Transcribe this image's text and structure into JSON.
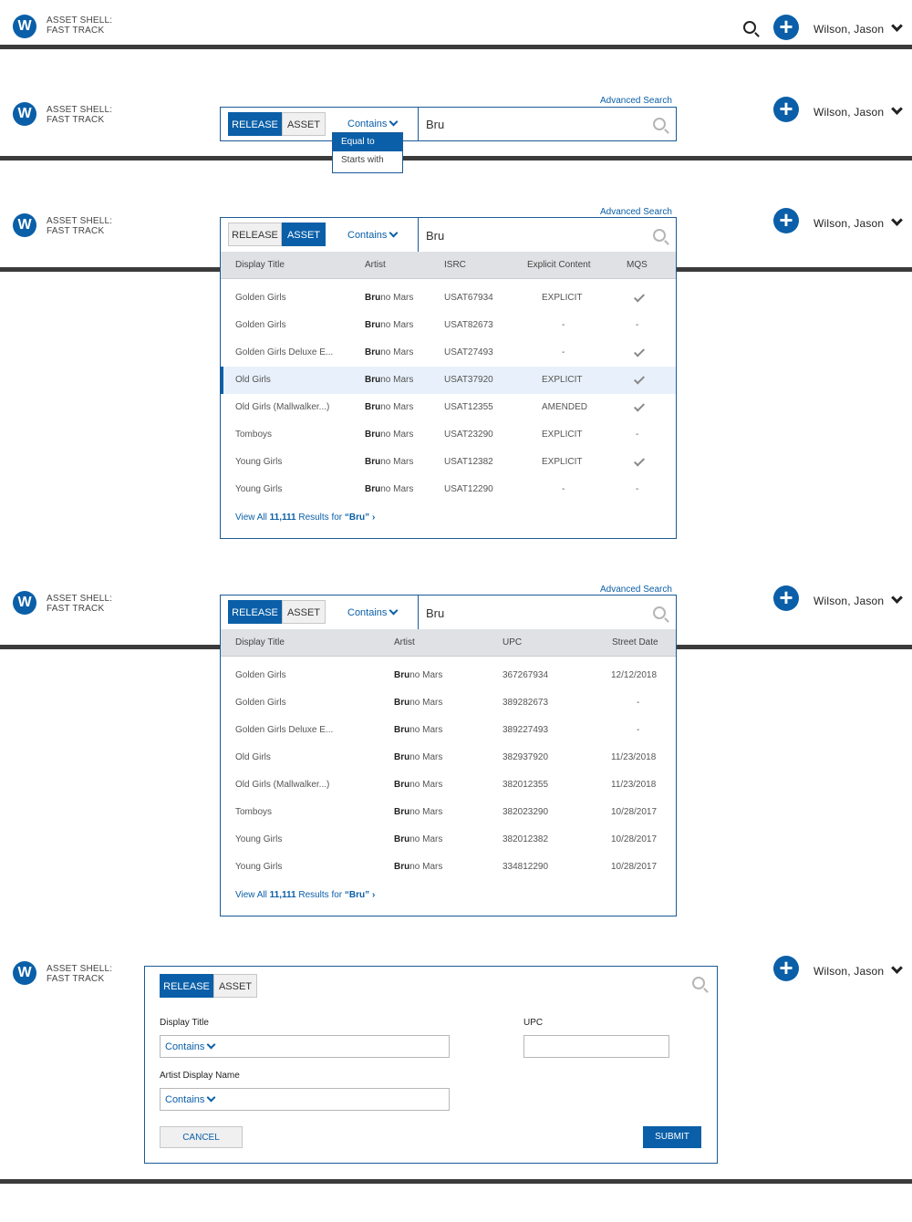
{
  "brand": {
    "line1": "ASSET SHELL:",
    "line2": "FAST TRACK",
    "logo_glyph": "W"
  },
  "user": {
    "name": "Wilson, Jason"
  },
  "search": {
    "tabs": {
      "release": "RELEASE",
      "asset": "ASSET"
    },
    "operator": "Contains",
    "query": "Bru",
    "advanced_label": "Advanced Search",
    "operator_options": [
      "Equal to",
      "Starts with"
    ]
  },
  "asset_table": {
    "headers": [
      "Display Title",
      "Artist",
      "ISRC",
      "Explicit Content",
      "MQS"
    ],
    "rows": [
      {
        "title": "Golden Girls",
        "artist_match": "Bru",
        "artist_rest": "no Mars",
        "isrc": "USAT67934",
        "explicit": "EXPLICIT",
        "mqs": "check"
      },
      {
        "title": "Golden Girls",
        "artist_match": "Bru",
        "artist_rest": "no Mars",
        "isrc": "USAT82673",
        "explicit": "-",
        "mqs": "-"
      },
      {
        "title": "Golden Girls Deluxe E...",
        "artist_match": "Bru",
        "artist_rest": "no Mars",
        "isrc": "USAT27493",
        "explicit": "-",
        "mqs": "check"
      },
      {
        "title": "Old Girls",
        "artist_match": "Bru",
        "artist_rest": "no Mars",
        "isrc": "USAT37920",
        "explicit": "EXPLICIT",
        "mqs": "check",
        "selected": true
      },
      {
        "title": "Old Girls (Mallwalker...)",
        "artist_match": "Bru",
        "artist_rest": "no Mars",
        "isrc": "USAT12355",
        "explicit": "AMENDED",
        "mqs": "check"
      },
      {
        "title": "Tomboys",
        "artist_match": "Bru",
        "artist_rest": "no Mars",
        "isrc": "USAT23290",
        "explicit": "EXPLICIT",
        "mqs": "-"
      },
      {
        "title": "Young Girls",
        "artist_match": "Bru",
        "artist_rest": "no Mars",
        "isrc": "USAT12382",
        "explicit": "EXPLICIT",
        "mqs": "check"
      },
      {
        "title": "Young Girls",
        "artist_match": "Bru",
        "artist_rest": "no Mars",
        "isrc": "USAT12290",
        "explicit": "-",
        "mqs": "-"
      }
    ]
  },
  "release_table": {
    "headers": [
      "Display Title",
      "Artist",
      "UPC",
      "Street Date"
    ],
    "rows": [
      {
        "title": "Golden Girls",
        "artist_match": "Bru",
        "artist_rest": "no Mars",
        "upc": "367267934",
        "date": "12/12/2018"
      },
      {
        "title": "Golden Girls",
        "artist_match": "Bru",
        "artist_rest": "no Mars",
        "upc": "389282673",
        "date": "-"
      },
      {
        "title": "Golden Girls Deluxe E...",
        "artist_match": "Bru",
        "artist_rest": "no Mars",
        "upc": "389227493",
        "date": "-"
      },
      {
        "title": "Old Girls",
        "artist_match": "Bru",
        "artist_rest": "no Mars",
        "upc": "382937920",
        "date": "11/23/2018"
      },
      {
        "title": "Old Girls (Mallwalker...)",
        "artist_match": "Bru",
        "artist_rest": "no Mars",
        "upc": "382012355",
        "date": "11/23/2018"
      },
      {
        "title": "Tomboys",
        "artist_match": "Bru",
        "artist_rest": "no Mars",
        "upc": "382023290",
        "date": "10/28/2017"
      },
      {
        "title": "Young Girls",
        "artist_match": "Bru",
        "artist_rest": "no Mars",
        "upc": "382012382",
        "date": "10/28/2017"
      },
      {
        "title": "Young Girls",
        "artist_match": "Bru",
        "artist_rest": "no Mars",
        "upc": "334812290",
        "date": "10/28/2017"
      }
    ]
  },
  "view_all": {
    "prefix": "View All ",
    "count": "11,111",
    "middle": " Results for ",
    "term": "“Bru”",
    "arrow": "›"
  },
  "advanced_form": {
    "display_title_label": "Display Title",
    "upc_label": "UPC",
    "artist_label": "Artist Display Name",
    "operator": "Contains",
    "cancel_label": "CANCEL",
    "submit_label": "SUBMIT"
  },
  "colors": {
    "accent": "#0a5fa8",
    "header_bar": "#3b3b3b",
    "table_header": "#dfe1e4",
    "selected_row": "#e8f1fb"
  }
}
